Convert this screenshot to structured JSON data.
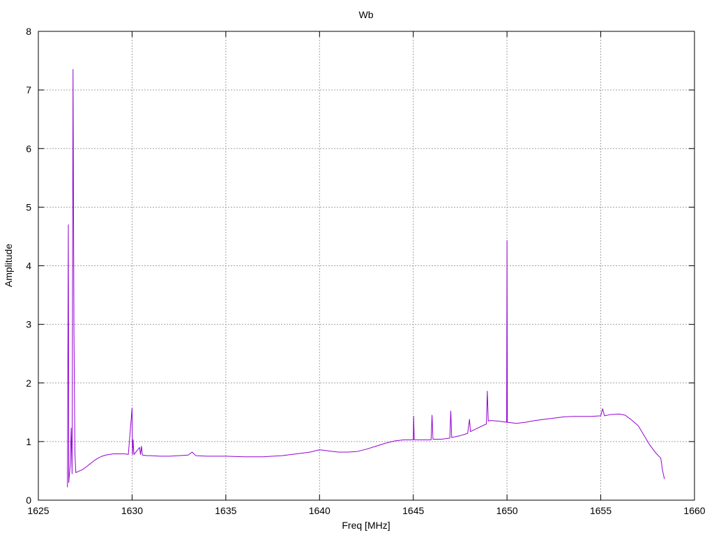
{
  "chart_data": {
    "type": "line",
    "title": "Wb",
    "xlabel": "Freq [MHz]",
    "ylabel": "Amplitude",
    "xlim": [
      1625,
      1660
    ],
    "ylim": [
      0,
      8
    ],
    "xticks": [
      1625,
      1630,
      1635,
      1640,
      1645,
      1650,
      1655,
      1660
    ],
    "yticks": [
      0,
      1,
      2,
      3,
      4,
      5,
      6,
      7,
      8
    ],
    "grid": true,
    "series_color": "#9400d3",
    "series": [
      {
        "x": [
          1626.55,
          1626.6,
          1626.62,
          1626.7,
          1626.75,
          1626.8,
          1626.85,
          1626.9,
          1626.95,
          1627.0,
          1627.2,
          1627.4,
          1627.6,
          1627.8,
          1628.0,
          1628.2,
          1628.4,
          1628.6,
          1628.8,
          1629.0,
          1629.2,
          1629.4,
          1629.6,
          1629.8,
          1630.0,
          1630.02,
          1630.05,
          1630.1,
          1630.4,
          1630.45,
          1630.5,
          1630.55,
          1630.8,
          1631.0,
          1631.5,
          1632.0,
          1632.5,
          1633.0,
          1633.2,
          1633.4,
          1634.0,
          1635.0,
          1636.0,
          1637.0,
          1637.5,
          1638.0,
          1638.5,
          1639.0,
          1639.5,
          1640.0,
          1640.5,
          1641.0,
          1641.5,
          1642.0,
          1642.5,
          1643.0,
          1643.5,
          1644.0,
          1644.5,
          1645.0,
          1645.02,
          1645.05,
          1645.5,
          1645.95,
          1646.0,
          1646.05,
          1646.5,
          1646.95,
          1647.0,
          1647.05,
          1647.5,
          1647.9,
          1648.0,
          1648.05,
          1648.5,
          1648.9,
          1648.95,
          1649.0,
          1649.1,
          1649.5,
          1649.98,
          1650.0,
          1650.02,
          1650.5,
          1651.0,
          1651.5,
          1652.0,
          1652.5,
          1653.0,
          1653.5,
          1654.0,
          1654.5,
          1655.0,
          1655.1,
          1655.2,
          1655.5,
          1656.0,
          1656.3,
          1656.6,
          1657.0,
          1657.3,
          1657.6,
          1657.9,
          1658.1,
          1658.2,
          1658.3,
          1658.4
        ],
        "values": [
          0.22,
          4.7,
          0.3,
          0.6,
          1.23,
          0.45,
          7.35,
          2.88,
          0.8,
          0.47,
          0.5,
          0.53,
          0.58,
          0.63,
          0.68,
          0.72,
          0.75,
          0.77,
          0.78,
          0.79,
          0.79,
          0.79,
          0.79,
          0.78,
          1.57,
          0.78,
          1.03,
          0.78,
          0.9,
          0.78,
          0.92,
          0.77,
          0.76,
          0.76,
          0.75,
          0.75,
          0.76,
          0.77,
          0.82,
          0.76,
          0.75,
          0.75,
          0.74,
          0.74,
          0.75,
          0.76,
          0.78,
          0.8,
          0.82,
          0.86,
          0.84,
          0.82,
          0.82,
          0.83,
          0.87,
          0.92,
          0.97,
          1.01,
          1.03,
          1.03,
          1.43,
          1.03,
          1.03,
          1.03,
          1.45,
          1.04,
          1.04,
          1.06,
          1.52,
          1.07,
          1.1,
          1.14,
          1.38,
          1.17,
          1.24,
          1.3,
          1.86,
          1.35,
          1.36,
          1.35,
          1.33,
          4.43,
          1.33,
          1.31,
          1.33,
          1.36,
          1.38,
          1.4,
          1.42,
          1.43,
          1.43,
          1.43,
          1.44,
          1.56,
          1.44,
          1.46,
          1.47,
          1.45,
          1.38,
          1.27,
          1.11,
          0.95,
          0.82,
          0.75,
          0.72,
          0.5,
          0.36
        ]
      }
    ]
  }
}
